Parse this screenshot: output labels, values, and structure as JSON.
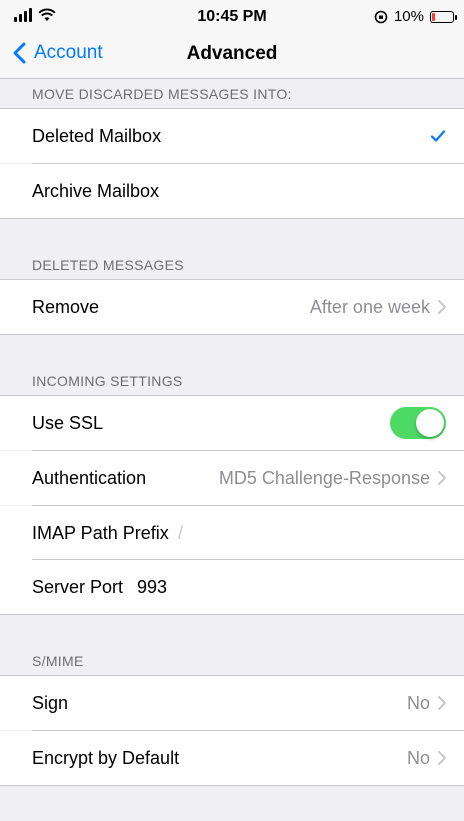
{
  "status_bar": {
    "time": "10:45 PM",
    "battery_percent": "10%"
  },
  "nav": {
    "back_label": "Account",
    "title": "Advanced"
  },
  "sections": {
    "discarded": {
      "header": "MOVE DISCARDED MESSAGES INTO:",
      "deleted_mailbox": "Deleted Mailbox",
      "archive_mailbox": "Archive Mailbox",
      "selected": "Deleted Mailbox"
    },
    "deleted_messages": {
      "header": "DELETED MESSAGES",
      "remove_label": "Remove",
      "remove_value": "After one week"
    },
    "incoming": {
      "header": "INCOMING SETTINGS",
      "use_ssl_label": "Use SSL",
      "use_ssl_on": true,
      "auth_label": "Authentication",
      "auth_value": "MD5 Challenge-Response",
      "imap_label": "IMAP Path Prefix",
      "imap_value": "/",
      "port_label": "Server Port",
      "port_value": "993"
    },
    "smime": {
      "header": "S/MIME",
      "sign_label": "Sign",
      "sign_value": "No",
      "encrypt_label": "Encrypt by Default",
      "encrypt_value": "No"
    }
  },
  "colors": {
    "accent": "#007aff",
    "toggle_on": "#4cd964",
    "battery_low": "#ff3b30"
  }
}
